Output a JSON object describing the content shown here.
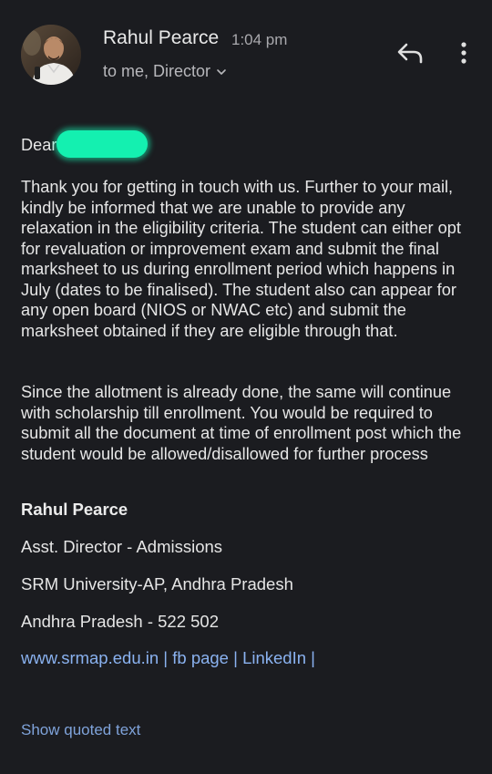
{
  "header": {
    "sender_name": "Rahul Pearce",
    "time": "1:04 pm",
    "recipients": "to me, Director",
    "icons": [
      "avatar",
      "chevron-down-icon",
      "reply-icon",
      "more-vert-icon"
    ]
  },
  "email": {
    "greeting": "Dear",
    "paragraph1": "Thank you for getting in touch with us. Further to your mail, kindly be informed that we are unable to provide any relaxation in the eligibility criteria. The student can either opt for revaluation or improvement exam and submit the final marksheet to us during enrollment period which happens in July (dates to be finalised). The student also can appear for any open board (NIOS or NWAC etc) and submit the marksheet obtained if they are eligible through that.",
    "paragraph2": "Since the allotment is already done, the same will continue with scholarship till enrollment. You would be required to submit all the document at time of enrollment post which the student would be allowed/disallowed for further process"
  },
  "signature": {
    "name": "Rahul Pearce",
    "title": "Asst. Director - Admissions",
    "org": "SRM University-AP, Andhra Pradesh",
    "address": "Andhra Pradesh - 522 502",
    "links": [
      "www.srmap.edu.in",
      "fb page",
      "LinkedIn"
    ],
    "separator": "|"
  },
  "footer": {
    "show_quoted": "Show quoted text"
  },
  "colors": {
    "background": "#1b1c20",
    "link": "#8ab2f0",
    "redaction": "#14f0b0"
  }
}
